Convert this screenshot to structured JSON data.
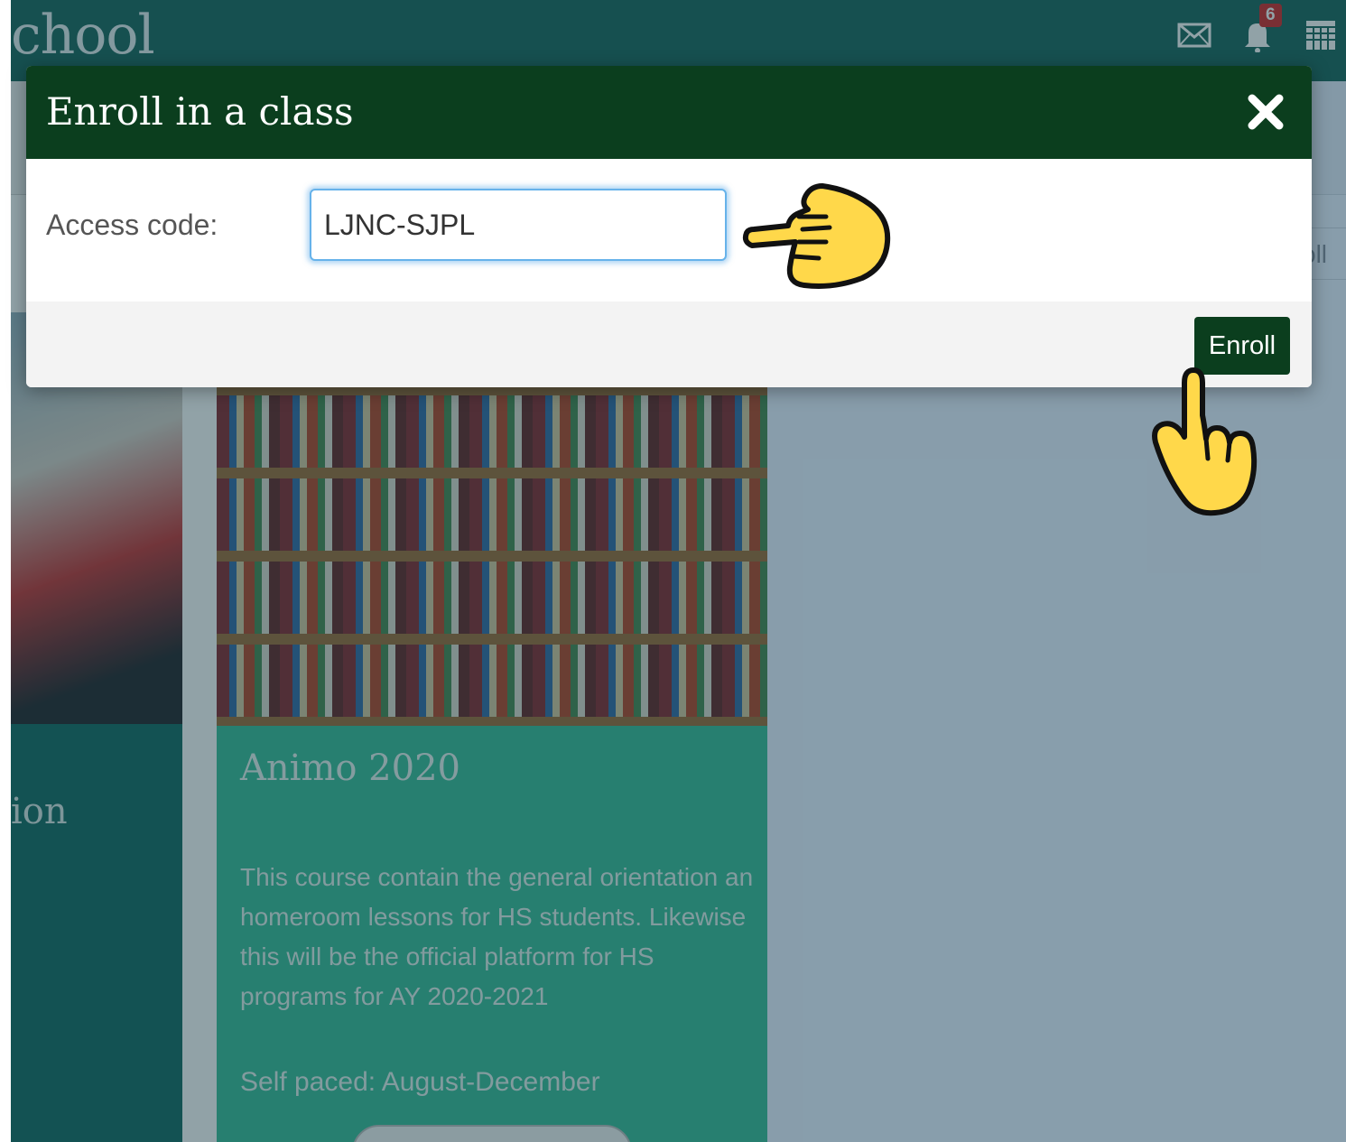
{
  "app": {
    "brand_text": "chool"
  },
  "header": {
    "icons": [
      "mail-icon",
      "bell-icon",
      "calendar-icon"
    ],
    "notification_count": "6"
  },
  "background": {
    "enroll_partial": "oll",
    "left_card_title_partial": "ion",
    "course_card": {
      "title": "Animo 2020",
      "description": "This course contain the general orientation an homeroom lessons for HS students. Likewise this will be the official platform for HS programs for AY 2020-2021",
      "pace": "Self paced: August-December"
    }
  },
  "modal": {
    "title": "Enroll in a class",
    "access_code_label": "Access code:",
    "access_code_value": "LJNC-SJPL",
    "enroll_button": "Enroll"
  },
  "colors": {
    "modal_header": "#0b3e1e",
    "card_teal": "#3fbf9c",
    "topbar": "#1f6b62",
    "input_focus": "#66b2ea",
    "pointer_hand": "#ffd84a"
  }
}
